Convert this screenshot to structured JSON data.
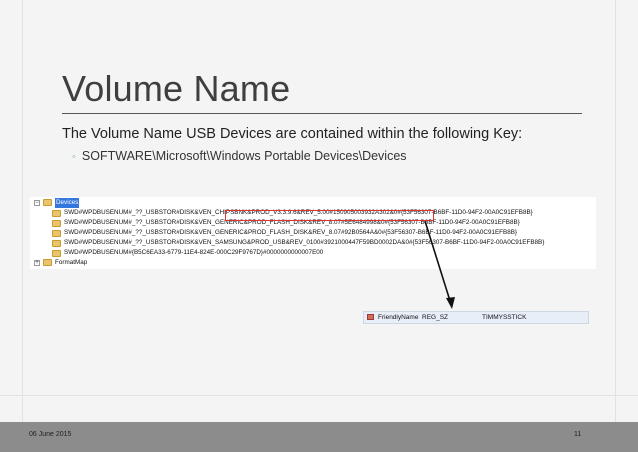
{
  "slide": {
    "title": "Volume Name",
    "body": "The Volume Name USB Devices are contained within the following Key:",
    "sub_bullet": "SOFTWARE\\Microsoft\\Windows Portable Devices\\Devices",
    "sub_bullet_icon": "circle-bullet-icon"
  },
  "registry_tree": {
    "root": "Devices",
    "children": [
      {
        "label": "SWD#WPDBUSENUM#_??_USBSTOR#DISK&VEN_CHIPSBNK&PROD_V3.3.9.6&REV_5.00#150905003932A302&0#{53F56307-B6BF-11D0-94F2-00A0C91EFB8B}"
      },
      {
        "label": "SWD#WPDBUSENUM#_??_USBSTOR#DISK&VEN_GENERIC&PROD_FLASH_DISK&REV_8.07#5E6484998&0#{53F56307-B6BF-11D0-94F2-00A0C91EFB8B}"
      },
      {
        "label": "SWD#WPDBUSENUM#_??_USBSTOR#DISK&VEN_GENERIC&PROD_FLASH_DISK&REV_8.07#92B0564A&0#{53F56307-B6BF-11D0-94F2-00A0C91EFB8B}"
      },
      {
        "label": "SWD#WPDBUSENUM#_??_USBSTOR#DISK&VEN_SAMSUNG&PROD_USB&REV_0100#3921000447F59BD0002DA&0#{53F56307-B6BF-11D0-94F2-00A0C91EFB8B}"
      },
      {
        "label": "SWD#WPDBUSENUM#{B5C6EA33-6779-11E4-824E-000C29F9767D}#0000000000007E00"
      }
    ],
    "next_key": "FormatMap"
  },
  "registry_value": {
    "name": "FriendlyName",
    "type": "REG_SZ",
    "data": "TIMMYSSTICK"
  },
  "footer": {
    "date": "06 June 2015",
    "page": "11"
  },
  "colors": {
    "highlight": "#dd3333",
    "footer": "#8c8c8c",
    "selection": "#3377dd"
  }
}
